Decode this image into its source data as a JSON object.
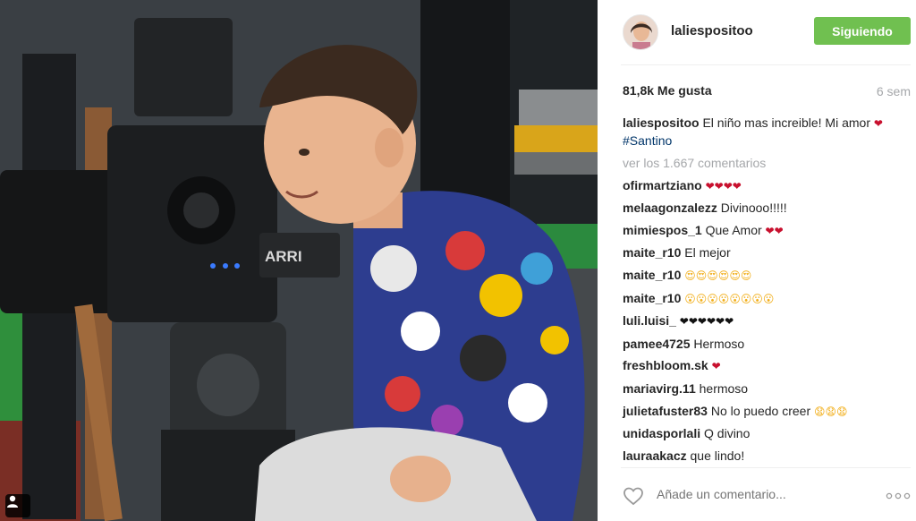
{
  "post": {
    "username": "laliespositoo",
    "follow_label": "Siguiendo",
    "likes": "81,8k Me gusta",
    "age": "6 sem",
    "caption": {
      "user": "laliespositoo",
      "text_before": "El niño mas increible! Mi amor",
      "emoji": "❤",
      "hashtag": "#Santino"
    },
    "view_all_label": "ver los 1.667 comentarios",
    "comments": [
      {
        "user": "ofirmartziano",
        "text": "",
        "emoji": "❤❤❤❤",
        "emoji_color": "red"
      },
      {
        "user": "melaagonzalezz",
        "text": "Divinooo!!!!!",
        "emoji": "",
        "emoji_color": ""
      },
      {
        "user": "mimiespos_1",
        "text": "Que Amor",
        "emoji": "❤❤",
        "emoji_color": "red"
      },
      {
        "user": "maite_r10",
        "text": "El mejor",
        "emoji": "",
        "emoji_color": ""
      },
      {
        "user": "maite_r10",
        "text": "",
        "emoji": "😍😍😍😍😍😍",
        "emoji_color": "yellow"
      },
      {
        "user": "maite_r10",
        "text": "",
        "emoji": "😮😮😮😮😮😮😮😮",
        "emoji_color": "yellow"
      },
      {
        "user": "luli.luisi_",
        "text": "",
        "emoji": "❤❤❤❤❤❤",
        "emoji_color": "black"
      },
      {
        "user": "pamee4725",
        "text": "Hermoso",
        "emoji": "",
        "emoji_color": ""
      },
      {
        "user": "freshbloom.sk",
        "text": "",
        "emoji": "❤",
        "emoji_color": "red"
      },
      {
        "user": "mariavirg.11",
        "text": "hermoso",
        "emoji": "",
        "emoji_color": ""
      },
      {
        "user": "julietafuster83",
        "text": "No lo puedo creer",
        "emoji": "😧😧😧",
        "emoji_color": "yellow"
      },
      {
        "user": "unidasporlali",
        "text": "Q divino",
        "emoji": "",
        "emoji_color": ""
      },
      {
        "user": "lauraakacz",
        "text": "que lindo!",
        "emoji": "",
        "emoji_color": ""
      }
    ],
    "comment_placeholder": "Añade un comentario...",
    "follow_color": "#70c050",
    "hashtag_color": "#003569",
    "meta_color": "#a5a7aa"
  },
  "photo": {
    "camera_brand": "ARRI"
  },
  "icons": {
    "like": "heart-outline-icon",
    "more": "ellipsis-icon",
    "user_tag": "person-icon"
  }
}
